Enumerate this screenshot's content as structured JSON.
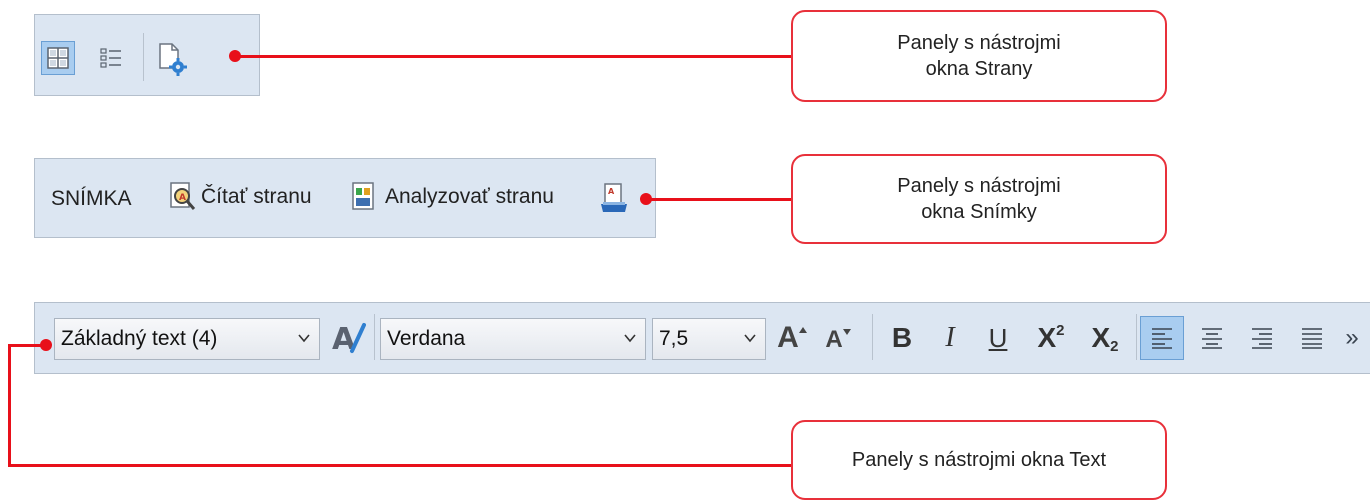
{
  "strany_toolbar": {
    "icons": [
      "thumbnails-view-icon",
      "details-view-icon",
      "page-properties-icon"
    ]
  },
  "snimka_toolbar": {
    "title": "SNÍMKA",
    "read_page_label": "Čítať stranu",
    "analyze_page_label": "Analyzovať stranu"
  },
  "text_toolbar": {
    "style_value": "Základný text (4)",
    "font_value": "Verdana",
    "size_value": "7,5",
    "grow_font_glyph": "A",
    "shrink_font_glyph": "A",
    "bold_glyph": "B",
    "italic_glyph": "I",
    "underline_glyph": "U",
    "superscript_glyph": "X",
    "superscript_sup": "2",
    "subscript_glyph": "X",
    "subscript_sub": "2",
    "more_glyph": "»"
  },
  "callouts": {
    "strany_line1": "Panely s nástrojmi",
    "strany_line2": "okna Strany",
    "snimky_line1": "Panely s nástrojmi",
    "snimky_line2": "okna Snímky",
    "text": "Panely s nástrojmi okna Text"
  },
  "colors": {
    "toolbar_bg": "#dce6f2",
    "callout_border": "#e8303a",
    "connector": "#e8101a",
    "active_button": "#9fc6ee"
  }
}
